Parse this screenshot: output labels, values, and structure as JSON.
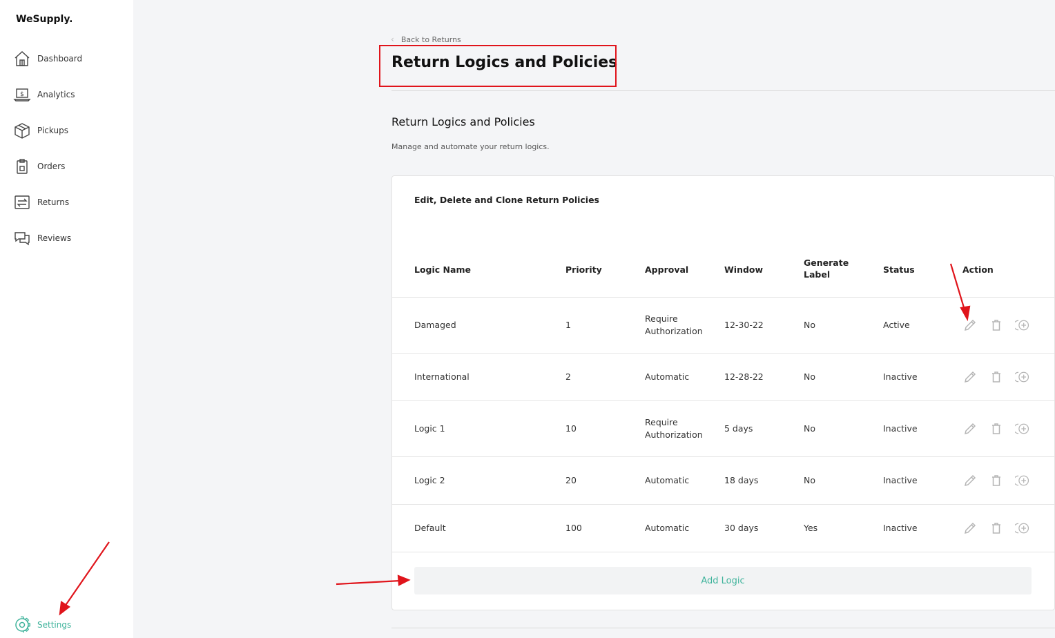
{
  "brand": "WeSupply.",
  "sidebar": {
    "items": [
      {
        "label": "Dashboard",
        "icon": "home-icon"
      },
      {
        "label": "Analytics",
        "icon": "analytics-icon"
      },
      {
        "label": "Pickups",
        "icon": "box-icon"
      },
      {
        "label": "Orders",
        "icon": "clipboard-icon"
      },
      {
        "label": "Returns",
        "icon": "returns-icon"
      },
      {
        "label": "Reviews",
        "icon": "chat-icon"
      }
    ],
    "settings": {
      "label": "Settings",
      "icon": "gear-icon"
    }
  },
  "header": {
    "back_label": "Back to Returns",
    "title": "Return Logics and Policies"
  },
  "section": {
    "title": "Return Logics and Policies",
    "description": "Manage and automate your return logics."
  },
  "card": {
    "title": "Edit, Delete and Clone Return Policies",
    "columns": {
      "name": "Logic Name",
      "priority": "Priority",
      "approval": "Approval",
      "window": "Window",
      "label1": "Generate",
      "label2": "Label",
      "status": "Status",
      "action": "Action"
    },
    "rows": [
      {
        "name": "Damaged",
        "priority": "1",
        "approval1": "Require",
        "approval2": "Authorization",
        "window": "12-30-22",
        "label": "No",
        "status": "Active"
      },
      {
        "name": "International",
        "priority": "2",
        "approval1": "Automatic",
        "approval2": "",
        "window": "12-28-22",
        "label": "No",
        "status": "Inactive"
      },
      {
        "name": "Logic 1",
        "priority": "10",
        "approval1": "Require",
        "approval2": "Authorization",
        "window": "5 days",
        "label": "No",
        "status": "Inactive"
      },
      {
        "name": "Logic 2",
        "priority": "20",
        "approval1": "Automatic",
        "approval2": "",
        "window": "18 days",
        "label": "No",
        "status": "Inactive"
      },
      {
        "name": "Default",
        "priority": "100",
        "approval1": "Automatic",
        "approval2": "",
        "window": "30 days",
        "label": "Yes",
        "status": "Inactive"
      }
    ],
    "add_label": "Add Logic"
  },
  "colors": {
    "accent": "#3fb39b",
    "annotation": "#e0141b",
    "icon_gray": "#b5b5b5"
  }
}
